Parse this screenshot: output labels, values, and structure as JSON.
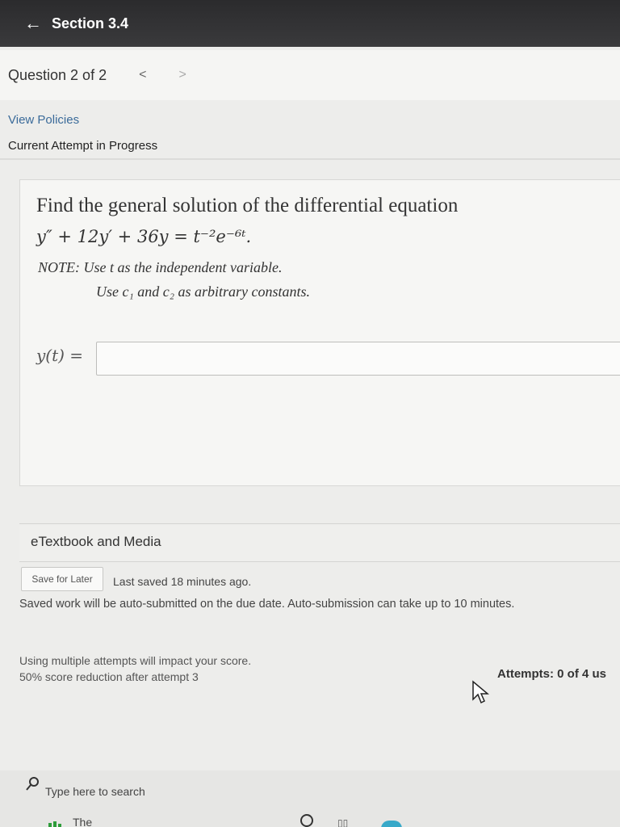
{
  "header": {
    "back_glyph": "←",
    "title": "Section 3.4"
  },
  "question_nav": {
    "label": "Question 2 of 2",
    "prev_glyph": "<",
    "next_glyph": ">"
  },
  "links": {
    "policies": "View Policies"
  },
  "status": {
    "attempt": "Current Attempt in Progress"
  },
  "question": {
    "prompt": "Find the general solution of the differential equation",
    "equation": "y″ + 12y′ + 36y = t⁻²e⁻⁶ᵗ.",
    "note1": "NOTE: Use t as the independent variable.",
    "note2": "Use c₁ and c₂ as arbitrary constants.",
    "answer_label": "y(t) =",
    "answer_value": ""
  },
  "resources": {
    "label": "eTextbook and Media"
  },
  "save": {
    "button_label": "Save for Later",
    "last_saved": "Last saved 18 minutes ago.",
    "auto_submit": "Saved work will be auto-submitted on the due date. Auto-submission can take up to 10 minutes."
  },
  "scoring": {
    "impact_line1": "Using multiple attempts will impact your score.",
    "impact_line2": "50% score reduction after attempt 3",
    "attempts": "Attempts: 0 of 4 us"
  },
  "taskbar": {
    "search_placeholder": "Type here to search",
    "weather_text": "The"
  },
  "colors": {
    "topbar": "#2b2b2d",
    "link": "#3b6b9a",
    "browser": "#38a9c9"
  }
}
